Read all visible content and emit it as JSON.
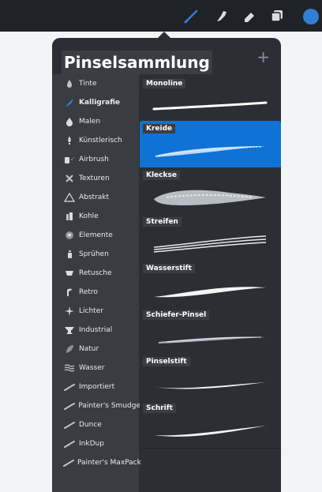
{
  "toolbar": {
    "tools": [
      "brush-icon",
      "smudge-icon",
      "eraser-icon",
      "layers-icon"
    ],
    "color": "#2e7fd6"
  },
  "library": {
    "title": "Pinselsammlung",
    "add_label": "+",
    "sets": [
      {
        "label": "Tinte",
        "icon": "ink-drop-icon"
      },
      {
        "label": "Kalligrafie",
        "icon": "calligraphy-icon",
        "selected": true
      },
      {
        "label": "Malen",
        "icon": "paint-drop-icon"
      },
      {
        "label": "Künstlerisch",
        "icon": "artist-brush-icon"
      },
      {
        "label": "Airbrush",
        "icon": "airbrush-icon"
      },
      {
        "label": "Texturen",
        "icon": "texture-icon"
      },
      {
        "label": "Abstrakt",
        "icon": "triangle-icon"
      },
      {
        "label": "Kohle",
        "icon": "charcoal-icon"
      },
      {
        "label": "Elemente",
        "icon": "globe-icon"
      },
      {
        "label": "Sprühen",
        "icon": "spray-can-icon"
      },
      {
        "label": "Retusche",
        "icon": "retouch-icon"
      },
      {
        "label": "Retro",
        "icon": "retro-icon"
      },
      {
        "label": "Lichter",
        "icon": "sparkle-icon"
      },
      {
        "label": "Industrial",
        "icon": "anvil-icon"
      },
      {
        "label": "Natur",
        "icon": "leaf-icon"
      },
      {
        "label": "Wasser",
        "icon": "waves-icon"
      },
      {
        "label": "Importiert",
        "icon": "stroke-icon"
      },
      {
        "label": "Painter's Smudge",
        "icon": "stroke-icon"
      },
      {
        "label": "Dunce",
        "icon": "stroke-icon"
      },
      {
        "label": "InkDup",
        "icon": "stroke-icon"
      },
      {
        "label": "Painter's MaxPack",
        "icon": "stroke-icon"
      }
    ],
    "brushes": [
      {
        "label": "Monoline"
      },
      {
        "label": "Kreide",
        "selected": true
      },
      {
        "label": "Kleckse"
      },
      {
        "label": "Streifen"
      },
      {
        "label": "Wasserstift"
      },
      {
        "label": "Schiefer-Pinsel"
      },
      {
        "label": "Pinselstift"
      },
      {
        "label": "Schrift"
      }
    ]
  }
}
